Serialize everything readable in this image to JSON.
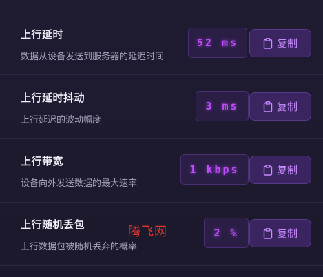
{
  "rows": [
    {
      "title": "上行延时",
      "description": "数据从设备发送到服务器的延迟时间",
      "value": "52 ms",
      "copy_label": "复制"
    },
    {
      "title": "上行延时抖动",
      "description": "上行延迟的波动幅度",
      "value": "3 ms",
      "copy_label": "复制"
    },
    {
      "title": "上行带宽",
      "description": "设备向外发送数据的最大速率",
      "value": "1 kbps",
      "copy_label": "复制"
    },
    {
      "title": "上行随机丢包",
      "description": "上行数据包被随机丢弃的概率",
      "value": "2 %",
      "copy_label": "复制"
    }
  ],
  "watermark": "腾飞网",
  "colors": {
    "value_text": "#c04dff",
    "button_text": "#c98cff",
    "watermark": "#e4372f"
  },
  "icons": {
    "copy": "clipboard-icon"
  }
}
